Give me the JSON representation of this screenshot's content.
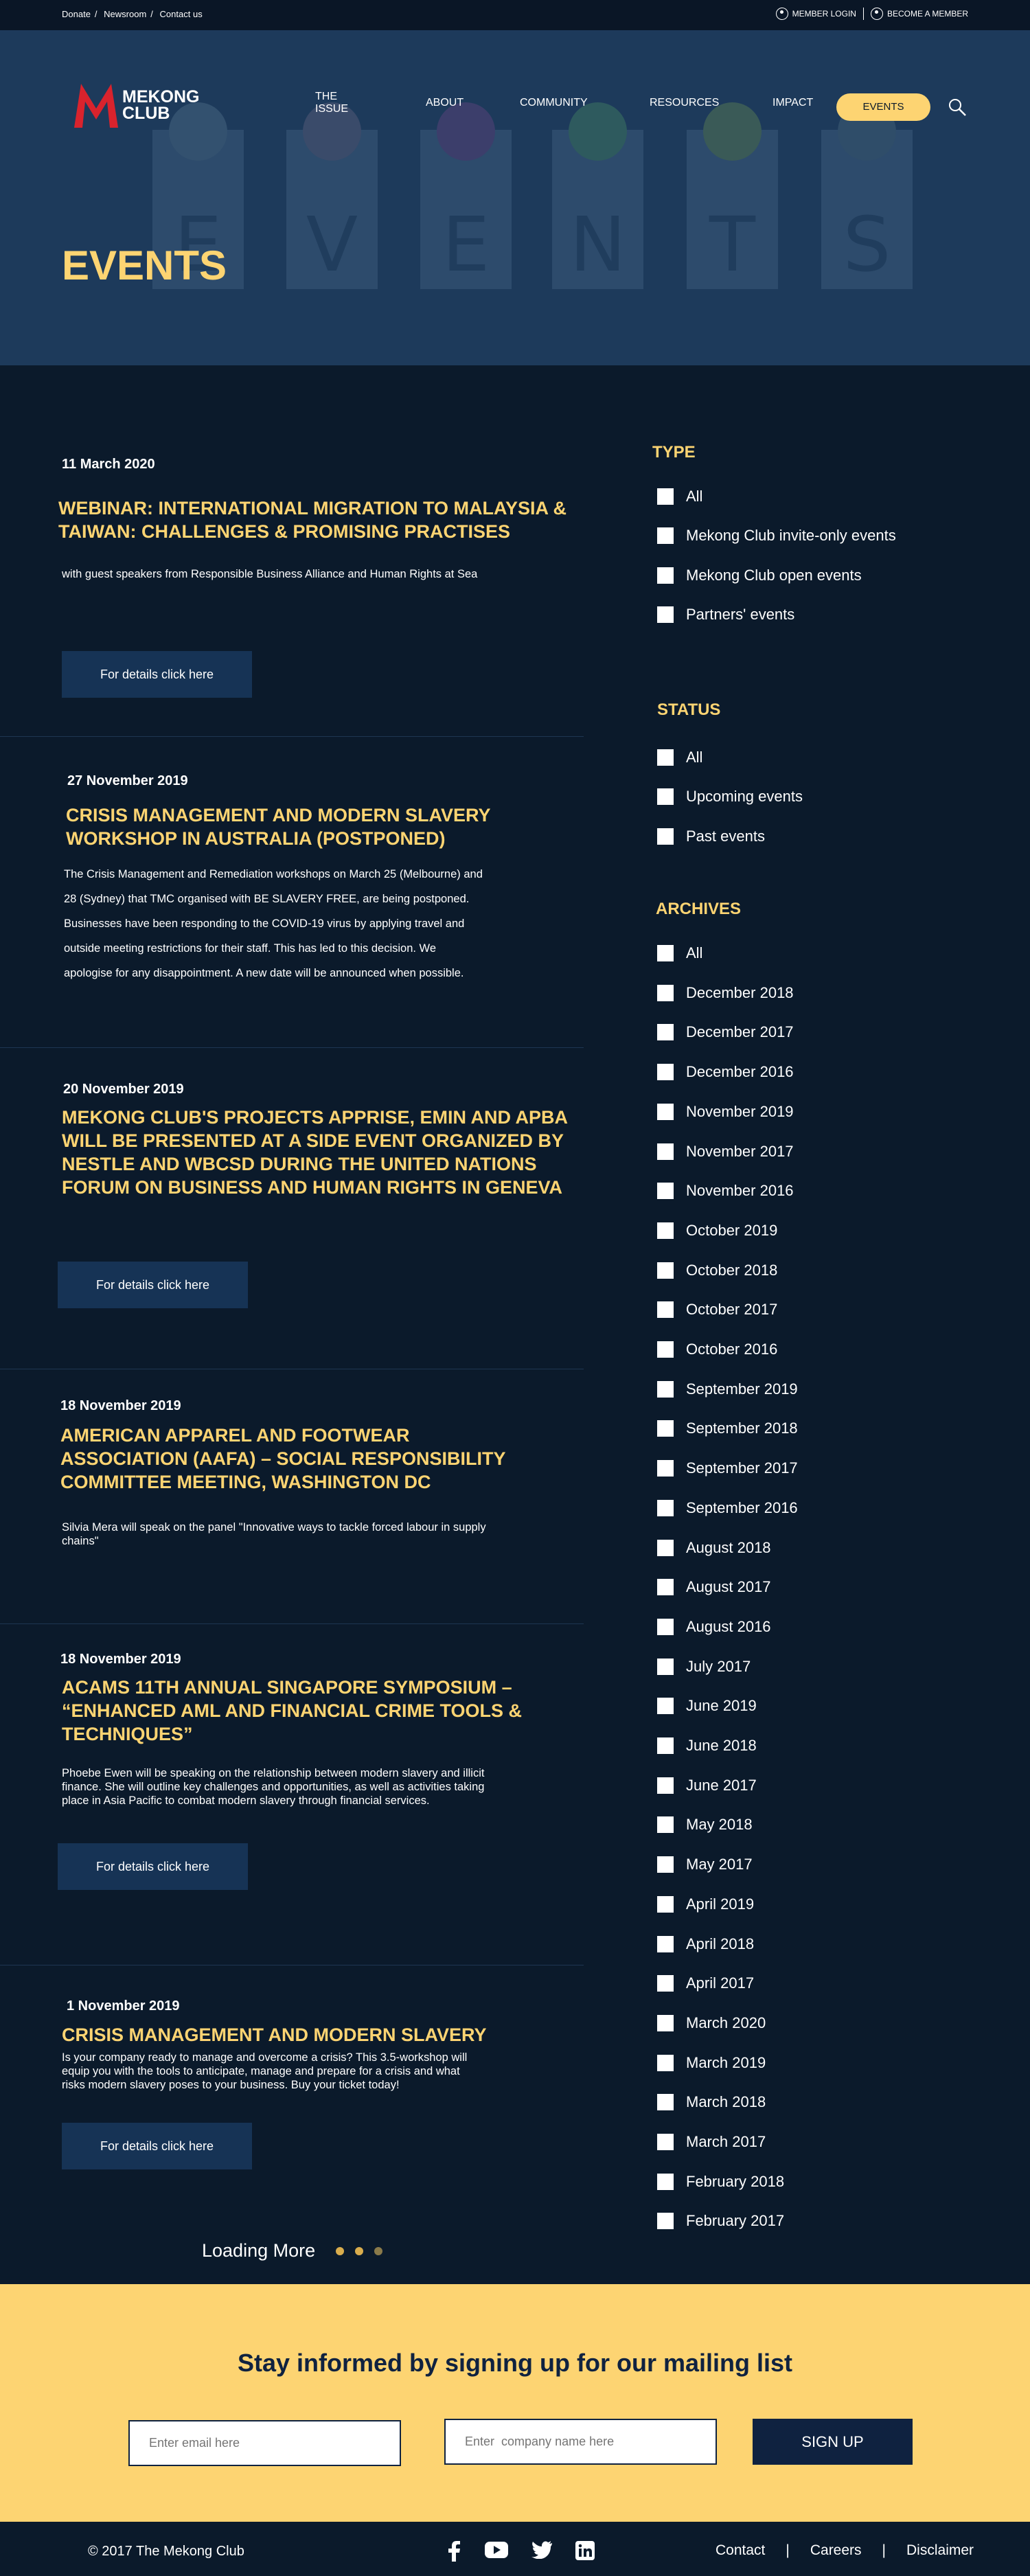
{
  "topbar": {
    "links": [
      "Donate",
      "Newsroom",
      "Contact us"
    ],
    "member_login": "MEMBER LOGIN",
    "become_member": "BECOME A MEMBER"
  },
  "logo": {
    "line1": "MEKONG",
    "line2": "CLUB"
  },
  "nav": [
    "THE ISSUE",
    "ABOUT",
    "COMMUNITY",
    "RESOURCES",
    "IMPACT"
  ],
  "nav_active": "EVENTS",
  "hero": {
    "title": "EVENTS",
    "letters": [
      "E",
      "V",
      "E",
      "N",
      "T",
      "S"
    ]
  },
  "events": [
    {
      "date": "11 March 2020",
      "title_lines": [
        "WEBINAR: INTERNATIONAL MIGRATION TO MALAYSIA &",
        "TAIWAN: CHALLENGES & PROMISING PRACTISES"
      ],
      "desc_lines": [
        "with guest speakers from Responsible Business Alliance and Human Rights at Sea"
      ],
      "button": "For details click here"
    },
    {
      "date": "27 November 2019",
      "title_lines": [
        "CRISIS MANAGEMENT AND MODERN SLAVERY",
        "WORKSHOP IN AUSTRALIA (POSTPONED)"
      ],
      "desc_lines": [
        "The Crisis Management and Remediation workshops on March 25 (Melbourne) and",
        "28 (Sydney) that TMC organised with BE SLAVERY FREE, are being postponed.",
        "Businesses have been responding to the COVID-19 virus by applying travel and",
        "outside meeting restrictions for their staff. This has led to this decision. We",
        "apologise for any disappointment. A new date will be announced when possible."
      ]
    },
    {
      "date": "20 November 2019",
      "title_lines": [
        "MEKONG CLUB'S PROJECTS APPRISE, EMIN AND APBA",
        "WILL BE PRESENTED AT A SIDE EVENT ORGANIZED BY",
        "NESTLE AND WBCSD DURING THE UNITED NATIONS",
        "FORUM ON BUSINESS AND HUMAN RIGHTS IN GENEVA"
      ],
      "button": "For details click here"
    },
    {
      "date": "18 November 2019",
      "title_lines": [
        "AMERICAN APPAREL AND FOOTWEAR",
        "ASSOCIATION (AAFA) – SOCIAL RESPONSIBILITY",
        "COMMITTEE MEETING, WASHINGTON DC"
      ],
      "desc_lines": [
        "Silvia Mera will speak on the panel \"Innovative ways to tackle forced labour in supply",
        "chains\""
      ]
    },
    {
      "date": "18 November 2019",
      "title_lines": [
        "ACAMS 11TH ANNUAL SINGAPORE SYMPOSIUM –",
        "“ENHANCED AML AND FINANCIAL CRIME TOOLS &",
        "TECHNIQUES”"
      ],
      "desc_lines": [
        "Phoebe Ewen will be speaking on the relationship between modern slavery and illicit",
        "finance. She will outline key challenges and opportunities, as well as activities taking",
        "place in Asia Pacific to combat modern slavery through financial services."
      ],
      "button": "For details click here"
    },
    {
      "date": "1 November 2019",
      "title_lines": [
        "CRISIS MANAGEMENT AND MODERN SLAVERY"
      ],
      "desc_lines": [
        "Is your company ready to manage and overcome a crisis? This 3.5-workshop will",
        "equip you with the tools to anticipate, manage and prepare for a crisis and what",
        "risks modern slavery poses to your business. Buy your ticket today!"
      ],
      "button": "For details click here"
    }
  ],
  "sidebar": {
    "type": {
      "heading": "TYPE",
      "options": [
        "All",
        "Mekong Club invite-only events",
        "Mekong Club open events",
        "Partners' events"
      ]
    },
    "status": {
      "heading": "STATUS",
      "options": [
        "All",
        "Upcoming events",
        "Past events"
      ]
    },
    "archives": {
      "heading": "ARCHIVES",
      "options": [
        "All",
        "December 2018",
        "December 2017",
        "December 2016",
        "November 2019",
        "November 2017",
        "November 2016",
        "October 2019",
        "October 2018",
        "October 2017",
        "October 2016",
        "September 2019",
        "September 2018",
        "September 2017",
        "September 2016",
        "August 2018",
        "August 2017",
        "August 2016",
        "July 2017",
        "June 2019",
        "June 2018",
        "June 2017",
        "May 2018",
        "May 2017",
        "April 2019",
        "April 2018",
        "April 2017",
        "March 2020",
        "March 2019",
        "March 2018",
        "March 2017",
        "February 2018",
        "February 2017"
      ]
    }
  },
  "loading": "Loading More",
  "newsletter": {
    "heading": "Stay informed by signing up for our mailing list",
    "email_placeholder": "Enter email here",
    "company_placeholder": "Enter  company name here",
    "button": "SIGN UP"
  },
  "footer": {
    "copyright": "© 2017 The Mekong Club",
    "social": [
      "facebook-icon",
      "youtube-icon",
      "twitter-icon",
      "linkedin-icon"
    ],
    "links": [
      "Contact",
      "|",
      "Careers",
      "|",
      "Disclaimer"
    ]
  },
  "colors": {
    "accent": "#fdd472",
    "background": "#0b1a2b",
    "hero": "#1d3a5b",
    "button": "#163355",
    "logo_red": "#d9232d"
  }
}
